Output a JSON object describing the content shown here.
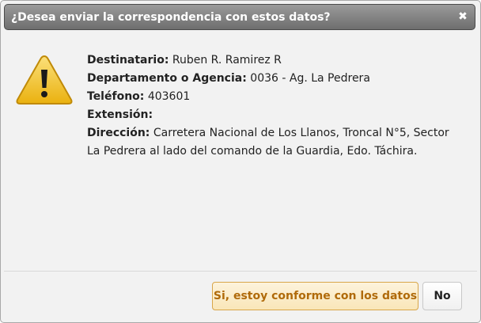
{
  "dialog": {
    "title": "¿Desea enviar la correspondencia con estos datos?",
    "close_glyph": "✖",
    "icon": "warning-icon"
  },
  "details": [
    {
      "label": "Destinatario:",
      "value": "Ruben R. Ramirez R"
    },
    {
      "label": "Departamento o Agencia:",
      "value": "0036 - Ag. La Pedrera"
    },
    {
      "label": "Teléfono:",
      "value": "403601"
    },
    {
      "label": "Extensión:",
      "value": ""
    },
    {
      "label": "Dirección:",
      "value": "Carretera Nacional de Los Llanos, Troncal N°5, Sector La Pedrera al lado del comando de la Guardia, Edo. Táchira."
    }
  ],
  "buttons": {
    "confirm_label": "Si, estoy conforme con los datos",
    "cancel_label": "No"
  },
  "colors": {
    "warning_fill": "#f5c518",
    "confirm_text": "#b06a0a",
    "titlebar": "#7a7a7a"
  }
}
